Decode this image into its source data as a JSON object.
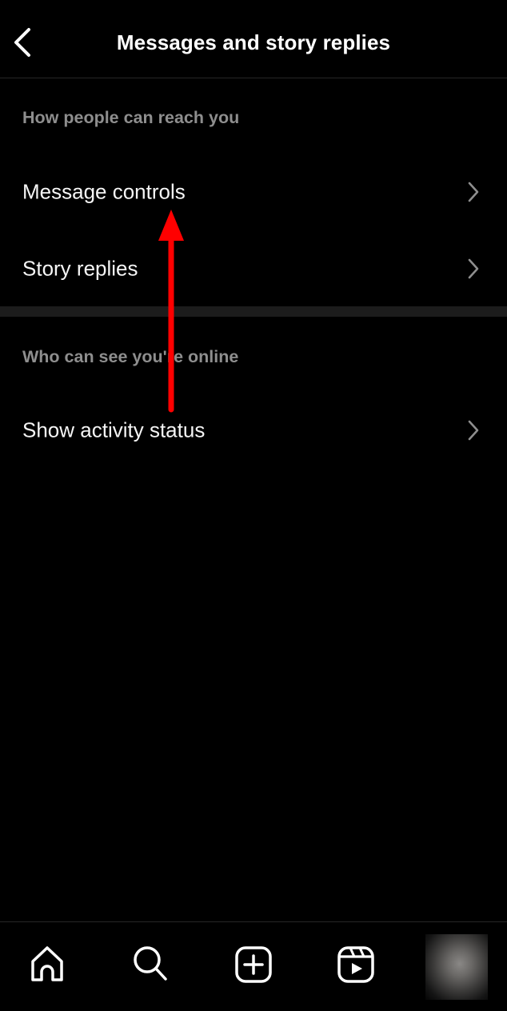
{
  "header": {
    "title": "Messages and story replies",
    "back_icon": "chevron-left-icon"
  },
  "sections": [
    {
      "label": "How people can reach you",
      "items": [
        {
          "label": "Message controls",
          "icon": "chevron-right-icon"
        },
        {
          "label": "Story replies",
          "icon": "chevron-right-icon"
        }
      ]
    },
    {
      "label": "Who can see you're online",
      "items": [
        {
          "label": "Show activity status",
          "icon": "chevron-right-icon"
        }
      ]
    }
  ],
  "annotation": {
    "type": "arrow-up",
    "color": "#ff0000",
    "points_to": "Message controls"
  },
  "bottom_nav": {
    "items": [
      {
        "name": "home",
        "icon": "home-icon"
      },
      {
        "name": "search",
        "icon": "search-icon"
      },
      {
        "name": "create",
        "icon": "plus-square-icon"
      },
      {
        "name": "reels",
        "icon": "reels-icon"
      },
      {
        "name": "profile",
        "icon": "avatar"
      }
    ]
  },
  "colors": {
    "background": "#000000",
    "text_primary": "#f5f5f5",
    "text_secondary": "#8e8e8e",
    "divider": "#1c1c1c",
    "border": "#262626",
    "annotation": "#ff0000"
  }
}
